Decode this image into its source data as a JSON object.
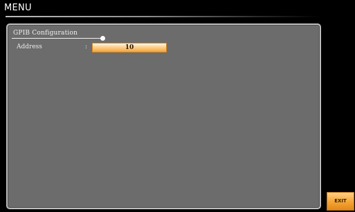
{
  "menu": {
    "title": "MENU"
  },
  "section": {
    "title": "GPIB Configuration"
  },
  "fields": {
    "address": {
      "label": "Address",
      "separator": ":",
      "value": "10"
    }
  },
  "softkeys": {
    "exit_label": "EXIT"
  },
  "colors": {
    "background": "#000000",
    "panel": "#6c6c6c",
    "panel_border": "#bdbdbd",
    "field_highlight": "#f4a43a",
    "softkey": "#f6a735"
  }
}
